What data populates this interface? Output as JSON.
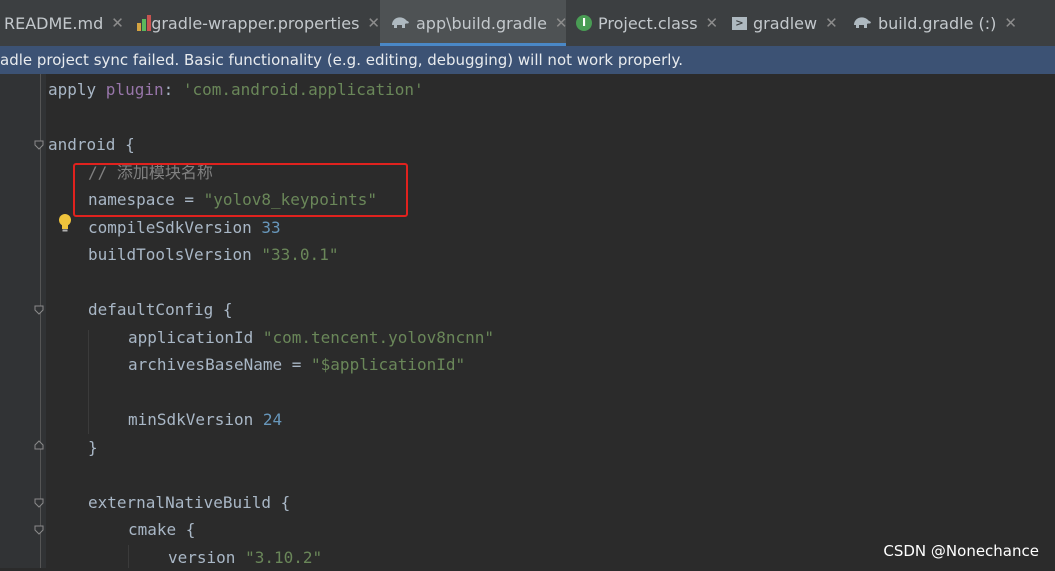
{
  "tabs": [
    {
      "label": "README.md",
      "icon": "markdown-file-icon",
      "active": false
    },
    {
      "label": "gradle-wrapper.properties",
      "icon": "properties-file-icon",
      "active": false
    },
    {
      "label": "app\\build.gradle",
      "icon": "gradle-elephant-icon",
      "active": true
    },
    {
      "label": "Project.class",
      "icon": "class-file-icon",
      "active": false
    },
    {
      "label": "gradlew",
      "icon": "terminal-file-icon",
      "active": false
    },
    {
      "label": "build.gradle (:)",
      "icon": "gradle-elephant-icon",
      "active": false
    }
  ],
  "close_glyph": "✕",
  "banner": {
    "text": "adle project sync failed. Basic functionality (e.g. editing, debugging) will not work properly."
  },
  "code": {
    "l1": {
      "a": "apply ",
      "b": "plugin",
      "c": ": ",
      "d": "'com.android.application'"
    },
    "l2": {
      "a": "android {"
    },
    "l3": {
      "a": "// 添加模块名称"
    },
    "l4": {
      "a": "namespace = ",
      "b": "\"yolov8_keypoints\""
    },
    "l5": {
      "a": "compileSdkVersion ",
      "b": "33"
    },
    "l6": {
      "a": "buildToolsVersion ",
      "b": "\"33.0.1\""
    },
    "l7": {
      "a": "defaultConfig {"
    },
    "l8": {
      "a": "applicationId ",
      "b": "\"com.tencent.yolov8ncnn\""
    },
    "l9": {
      "a": "archivesBaseName = ",
      "b": "\"$applicationId\""
    },
    "l10": {
      "a": "minSdkVersion ",
      "b": "24"
    },
    "l11": {
      "a": "}"
    },
    "l12": {
      "a": "externalNativeBuild {"
    },
    "l13": {
      "a": "cmake {"
    },
    "l14": {
      "a": "version ",
      "b": "\"3.10.2\""
    }
  },
  "watermark": "CSDN @Nonechance",
  "colors": {
    "accent": "#4a88c7",
    "banner_bg": "#3c5274",
    "highlight_box": "#e0221e"
  }
}
